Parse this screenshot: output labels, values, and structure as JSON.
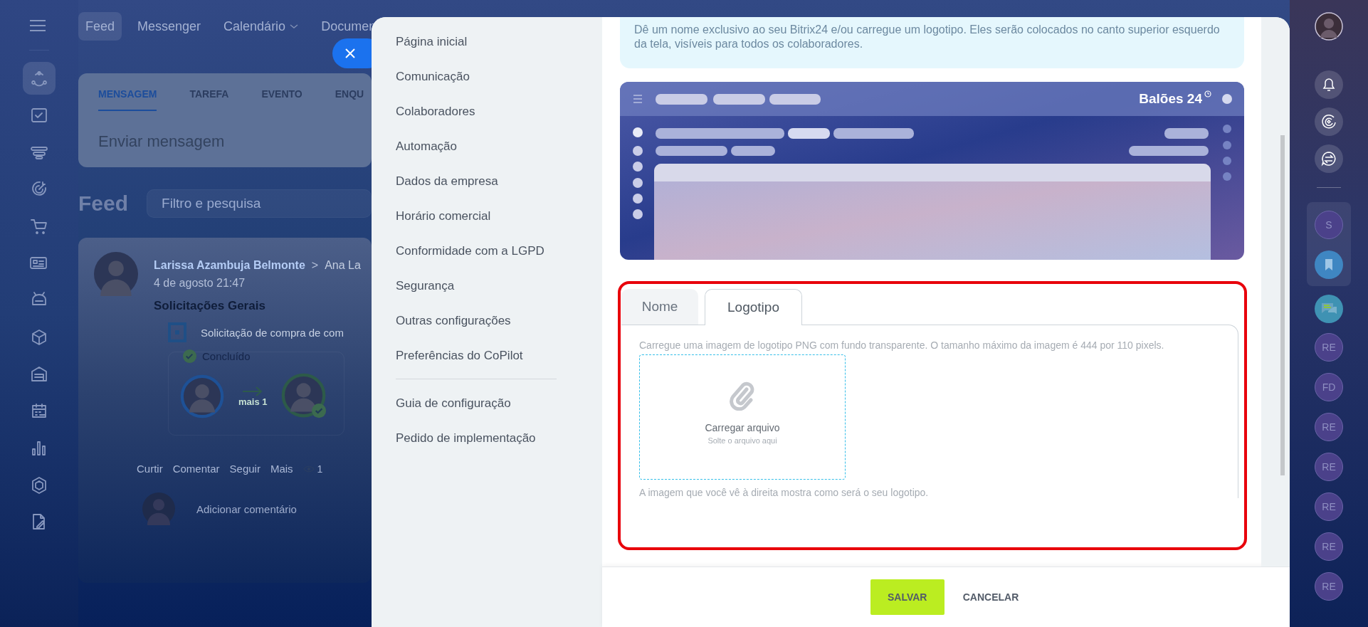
{
  "app_nav": {
    "items": [
      {
        "label": "Feed",
        "selected": true,
        "dropdown": false
      },
      {
        "label": "Messenger",
        "selected": false,
        "dropdown": false
      },
      {
        "label": "Calendário",
        "selected": false,
        "dropdown": true
      },
      {
        "label": "Documen",
        "selected": false,
        "dropdown": false
      }
    ]
  },
  "left_nav": [
    {
      "selected": true
    },
    {
      "selected": false
    },
    {
      "selected": false
    },
    {
      "selected": false
    },
    {
      "selected": false
    },
    {
      "selected": false
    },
    {
      "selected": false
    },
    {
      "selected": false
    },
    {
      "selected": false
    },
    {
      "selected": false
    },
    {
      "selected": false
    },
    {
      "selected": false
    },
    {
      "selected": false
    }
  ],
  "composer": {
    "tabs": [
      {
        "label": "MENSAGEM",
        "selected": true
      },
      {
        "label": "TAREFA",
        "selected": false
      },
      {
        "label": "EVENTO",
        "selected": false
      },
      {
        "label": "ENQU",
        "selected": false
      }
    ],
    "placeholder": "Enviar mensagem"
  },
  "feed": {
    "title": "Feed",
    "search_placeholder": "Filtro e pesquisa"
  },
  "post": {
    "author": "Larissa Azambuja Belmonte",
    "separator": ">",
    "recipient": "Ana La",
    "time": "4 de agosto 21:47",
    "title": "Solicitações Gerais",
    "request": "Solicitação de compra de com",
    "status": "Concluído",
    "more": "mais 1",
    "actions": [
      "Curtir",
      "Comentar",
      "Seguir",
      "Mais"
    ],
    "views": "1",
    "comment_placeholder": "Adicionar comentário"
  },
  "settings_menu": {
    "items": [
      "Página inicial",
      "Comunicação",
      "Colaboradores",
      "Automação",
      "Dados da empresa",
      "Horário comercial",
      "Conformidade com a LGPD",
      "Segurança",
      "Outras configurações",
      "Preferências do CoPilot"
    ],
    "extra": [
      "Guia de configuração",
      "Pedido de implementação"
    ]
  },
  "intro": "Dê um nome exclusivo ao seu Bitrix24 e/ou carregue um logotipo. Eles serão colocados no canto superior esquerdo da tela, visíveis para todos os colaboradores.",
  "preview": {
    "logo_text": "Balões 24"
  },
  "logo_form": {
    "tabs": [
      {
        "label": "Nome",
        "selected": false
      },
      {
        "label": "Logotipo",
        "selected": true
      }
    ],
    "hint": "Carregue uma imagem de logotipo PNG com fundo transparente. O tamanho máximo da imagem é 444 por 110 pixels.",
    "upload": {
      "label": "Carregar arquivo",
      "sublabel": "Solte o arquivo aqui"
    },
    "note": "A imagem que você vê à direita mostra como será o seu logotipo."
  },
  "buttons": [
    {
      "label": "SALVAR",
      "kind": "primary"
    },
    {
      "label": "CANCELAR",
      "kind": "link"
    }
  ],
  "right_bar": {
    "pinned": [
      {
        "kind": "letter",
        "label": "S"
      },
      {
        "kind": "bookmark"
      }
    ],
    "chats": [
      {
        "kind": "chat"
      },
      {
        "kind": "letter",
        "label": "RE"
      },
      {
        "kind": "letter",
        "label": "FD"
      },
      {
        "kind": "letter",
        "label": "RE"
      },
      {
        "kind": "letter",
        "label": "RE"
      },
      {
        "kind": "letter",
        "label": "RE"
      },
      {
        "kind": "letter",
        "label": "RE"
      },
      {
        "kind": "letter",
        "label": "RE"
      }
    ]
  }
}
